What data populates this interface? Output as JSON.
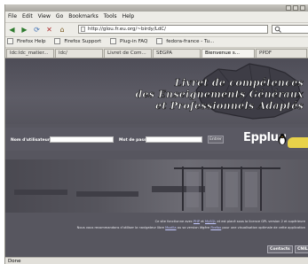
{
  "menu": [
    "File",
    "Edit",
    "View",
    "Go",
    "Bookmarks",
    "Tools",
    "Help"
  ],
  "address": {
    "url": "http://glou.fr.eu.org/~birdy/LdC/"
  },
  "bookmarks": [
    "Firefox Help",
    "Firefox Support",
    "Plug-in FAQ",
    "fedora-france - Tu..."
  ],
  "tabs": [
    "ldc:ldc_matier...",
    "ldc/",
    "Livret de Com...",
    "SEGPA",
    "Bienvenue s...",
    "PPDF"
  ],
  "header": {
    "title_line1": "Livret de compétences",
    "title_line2": "des Enseignements Généraux",
    "title_line3": "et Professionnels Adaptés"
  },
  "login": {
    "username_label": "Nom d'utilisateur :",
    "password_label": "Mot de passe :",
    "submit_label": "Entrer"
  },
  "logo": {
    "text": "Epplug"
  },
  "footer": {
    "line1_a": "Ce site fonctionne avec",
    "line1_link1": "PHP",
    "line1_b": "et",
    "line1_link2": "MySQL",
    "line1_c": "et est placé sous la licence GPL version 2 et supérieure",
    "line2_a": "Nous vous recommandons d'utiliser la navigateur libre",
    "line2_link1": "Mozilla",
    "line2_b": "ou sa version légère",
    "line2_link2": "Firefox",
    "line2_c": "pour une visualisation optimale de cette application",
    "contacts_label": "Contacts",
    "cnil_label": "CNIL"
  },
  "status": {
    "text": "Done"
  },
  "colors": {
    "page_bg": "#57565f",
    "chrome_bg": "#edece7",
    "logo_accent": "#e8d24a"
  }
}
